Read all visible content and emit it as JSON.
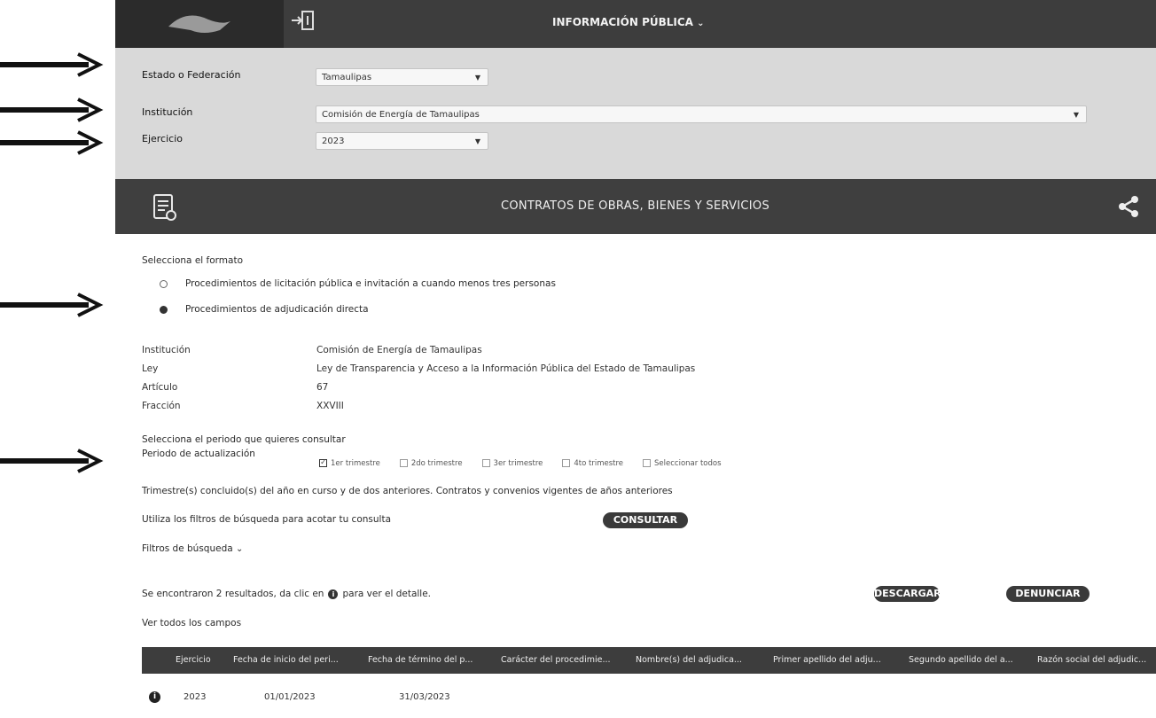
{
  "header": {
    "title": "INFORMACIÓN PÚBLICA"
  },
  "filters": {
    "estado_label": "Estado o Federación",
    "estado_value": "Tamaulipas",
    "institucion_label": "Institución",
    "institucion_value": "Comisión de Energía de Tamaulipas",
    "ejercicio_label": "Ejercicio",
    "ejercicio_value": "2023"
  },
  "section": {
    "title": "CONTRATOS DE OBRAS, BIENES Y SERVICIOS"
  },
  "format": {
    "prompt": "Selecciona el formato",
    "option1": "Procedimientos de licitación pública e invitación a cuando menos tres personas",
    "option2": "Procedimientos de adjudicación directa",
    "selected": "option2"
  },
  "meta": {
    "institucion_key": "Institución",
    "institucion_val": "Comisión de Energía de Tamaulipas",
    "ley_key": "Ley",
    "ley_val": "Ley de Transparencia y Acceso a la Información Pública del Estado de Tamaulipas",
    "articulo_key": "Artículo",
    "articulo_val": "67",
    "fraccion_key": "Fracción",
    "fraccion_val": "XXVIII"
  },
  "periodo": {
    "prompt": "Selecciona el periodo que quieres consultar",
    "label": "Periodo de actualización",
    "options": [
      "1er trimestre",
      "2do trimestre",
      "3er trimestre",
      "4to trimestre",
      "Seleccionar todos"
    ],
    "checked": [
      true,
      false,
      false,
      false,
      false
    ],
    "note": "Trimestre(s) concluido(s) del año en curso y de dos anteriores. Contratos y convenios vigentes de años anteriores"
  },
  "search": {
    "hint": "Utiliza los filtros de búsqueda para acotar tu consulta",
    "consultar_label": "CONSULTAR",
    "filtros_label": "Filtros de búsqueda"
  },
  "results": {
    "summary_pre": "Se encontraron 2 resultados, da clic en",
    "summary_post": "para ver el detalle.",
    "ver_todos": "Ver todos los campos",
    "descargar_label": "DESCARGAR",
    "denunciar_label": "DENUNCIAR"
  },
  "table": {
    "columns": [
      "Ejercicio",
      "Fecha de inicio del peri...",
      "Fecha de término del p...",
      "Carácter del procedimie...",
      "Nombre(s) del adjudica...",
      "Primer apellido del adju...",
      "Segundo apellido del a...",
      "Razón social del adjudic..."
    ],
    "row1": [
      "2023",
      "01/01/2023",
      "31/03/2023"
    ]
  }
}
